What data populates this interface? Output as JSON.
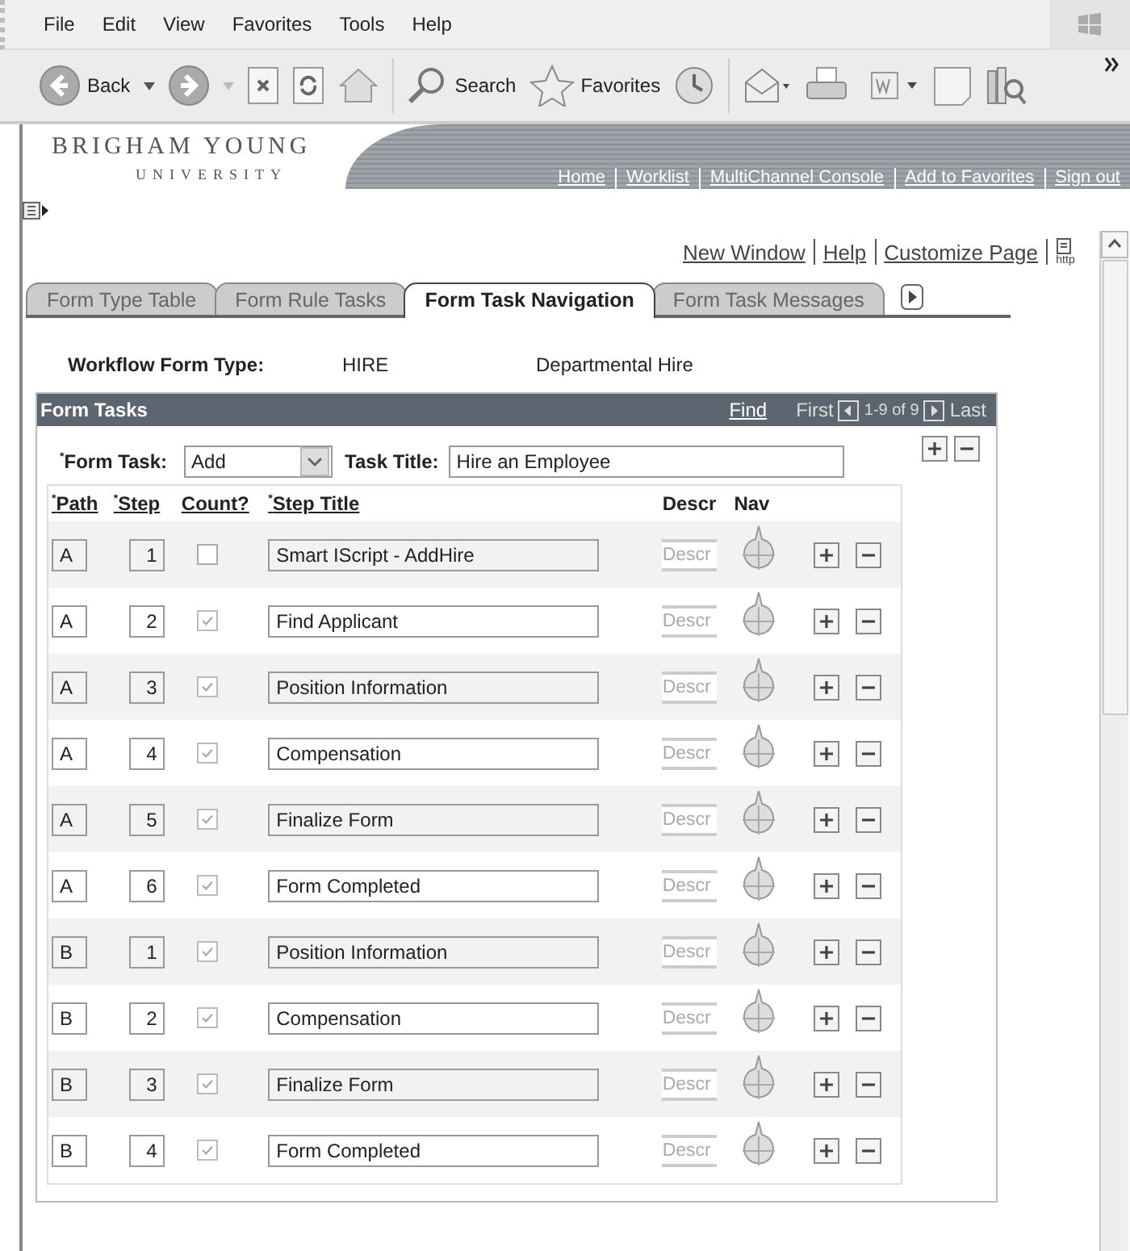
{
  "menu": [
    "File",
    "Edit",
    "View",
    "Favorites",
    "Tools",
    "Help"
  ],
  "toolbar": {
    "back_label": "Back",
    "search_label": "Search",
    "favorites_label": "Favorites"
  },
  "header": {
    "logo_line1": "BRIGHAM YOUNG",
    "logo_line2": "UNIVERSITY",
    "links": [
      "Home",
      "Worklist",
      "MultiChannel Console",
      "Add to Favorites",
      "Sign out"
    ]
  },
  "page_links": [
    "New Window",
    "Help",
    "Customize Page"
  ],
  "http_label": "http",
  "tabs": [
    {
      "label": "Form Type Table",
      "selected": false
    },
    {
      "label": "Form Rule Tasks",
      "selected": false
    },
    {
      "label": "Form Task Navigation",
      "selected": true
    },
    {
      "label": "Form Task Messages",
      "selected": false
    }
  ],
  "form_type": {
    "label": "Workflow Form Type:",
    "code": "HIRE",
    "description": "Departmental Hire"
  },
  "grid": {
    "title": "Form Tasks",
    "find": "Find",
    "first": "First",
    "range": "1-9 of 9",
    "last": "Last",
    "form_task_label": "$^{*}$Form Task:",
    "form_task_value": "Add",
    "task_title_label": "Task Title:",
    "task_title_value": "Hire an Employee",
    "columns": [
      "$^{*}$Path",
      "$^{*}$Step",
      "Count?",
      "$^{*}$Step Title",
      "Descr",
      "Nav"
    ],
    "rows": [
      {
        "path": "A",
        "step": "1",
        "checked": false,
        "title": "Smart IScript - AddHire",
        "descr": "Descr"
      },
      {
        "path": "A",
        "step": "2",
        "checked": true,
        "title": "Find Applicant",
        "descr": "Descr"
      },
      {
        "path": "A",
        "step": "3",
        "checked": true,
        "title": "Position Information",
        "descr": "Descr"
      },
      {
        "path": "A",
        "step": "4",
        "checked": true,
        "title": "Compensation",
        "descr": "Descr"
      },
      {
        "path": "A",
        "step": "5",
        "checked": true,
        "title": "Finalize Form",
        "descr": "Descr"
      },
      {
        "path": "A",
        "step": "6",
        "checked": true,
        "title": "Form Completed",
        "descr": "Descr"
      },
      {
        "path": "B",
        "step": "1",
        "checked": true,
        "title": "Position Information",
        "descr": "Descr"
      },
      {
        "path": "B",
        "step": "2",
        "checked": true,
        "title": "Compensation",
        "descr": "Descr"
      },
      {
        "path": "B",
        "step": "3",
        "checked": true,
        "title": "Finalize Form",
        "descr": "Descr"
      },
      {
        "path": "B",
        "step": "4",
        "checked": true,
        "title": "Form Completed",
        "descr": "Descr"
      }
    ]
  }
}
